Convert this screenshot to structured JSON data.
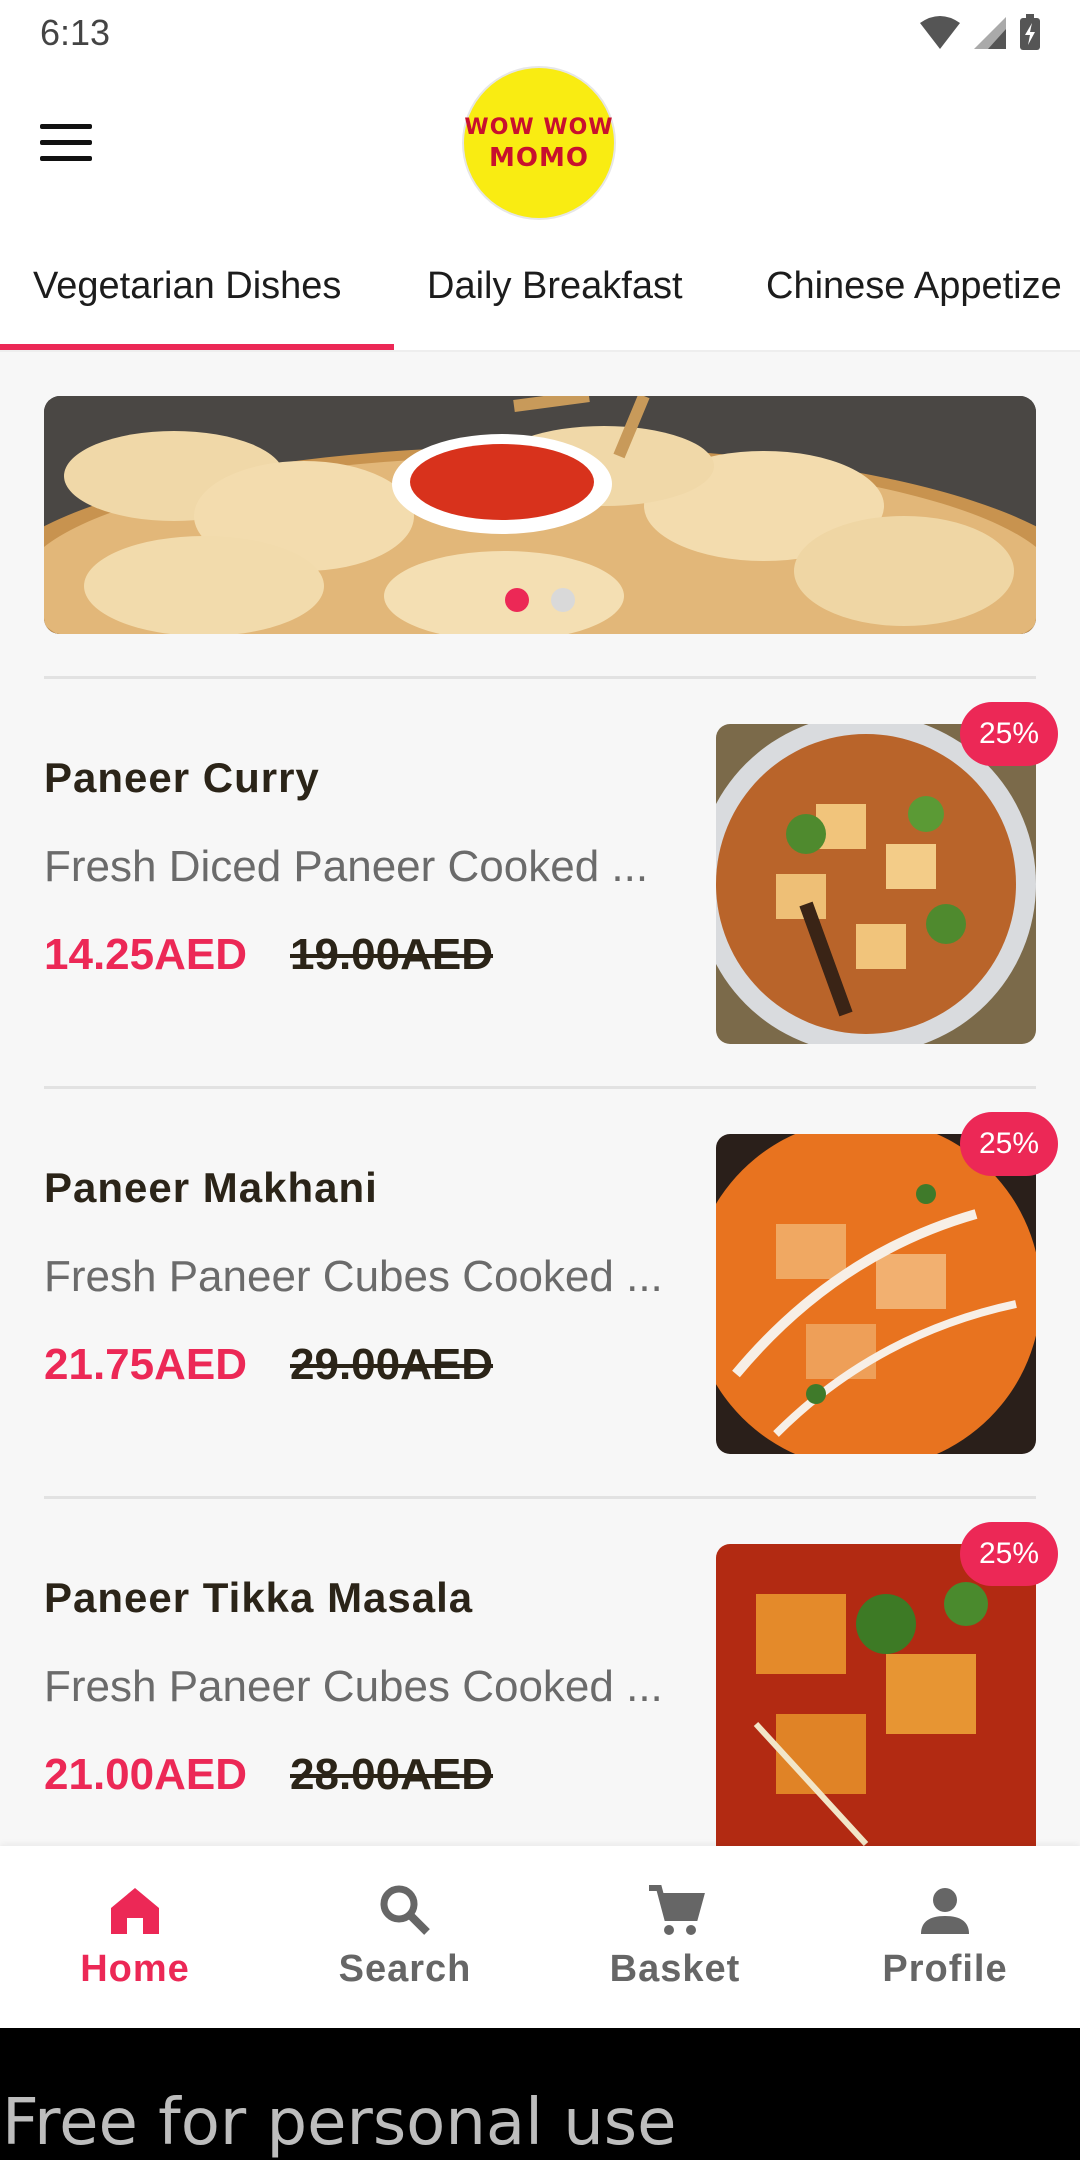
{
  "status_bar": {
    "time": "6:13",
    "icons": [
      "wifi-icon",
      "signal-icon",
      "battery-icon"
    ]
  },
  "header": {
    "logo_line1": "WOW WOW",
    "logo_line2": "MOMO",
    "menu_icon": "hamburger-menu-icon"
  },
  "tabs": [
    {
      "label": "Vegetarian Dishes",
      "active": true
    },
    {
      "label": "Daily Breakfast",
      "active": false
    },
    {
      "label": "Chinese Appetize",
      "active": false
    }
  ],
  "banner": {
    "slides": 2,
    "active_slide": 1
  },
  "items": [
    {
      "name": "Paneer Curry",
      "desc": "Fresh Diced Paneer Cooked ...",
      "price": "14.25AED",
      "old_price": "19.00AED",
      "discount": "25%"
    },
    {
      "name": "Paneer Makhani",
      "desc": "Fresh Paneer Cubes Cooked ...",
      "price": "21.75AED",
      "old_price": "29.00AED",
      "discount": "25%"
    },
    {
      "name": "Paneer Tikka Masala",
      "desc": "Fresh Paneer Cubes Cooked ...",
      "price": "21.00AED",
      "old_price": "28.00AED",
      "discount": "25%"
    }
  ],
  "bottom_nav": [
    {
      "label": "Home",
      "icon": "home-icon",
      "active": true
    },
    {
      "label": "Search",
      "icon": "search-icon",
      "active": false
    },
    {
      "label": "Basket",
      "icon": "cart-icon",
      "active": false
    },
    {
      "label": "Profile",
      "icon": "person-icon",
      "active": false
    }
  ],
  "watermark": "Free for personal use",
  "colors": {
    "accent": "#ec2856",
    "price": "#ec2856",
    "text": "#2b2418",
    "logo_bg": "#f9ec12"
  }
}
